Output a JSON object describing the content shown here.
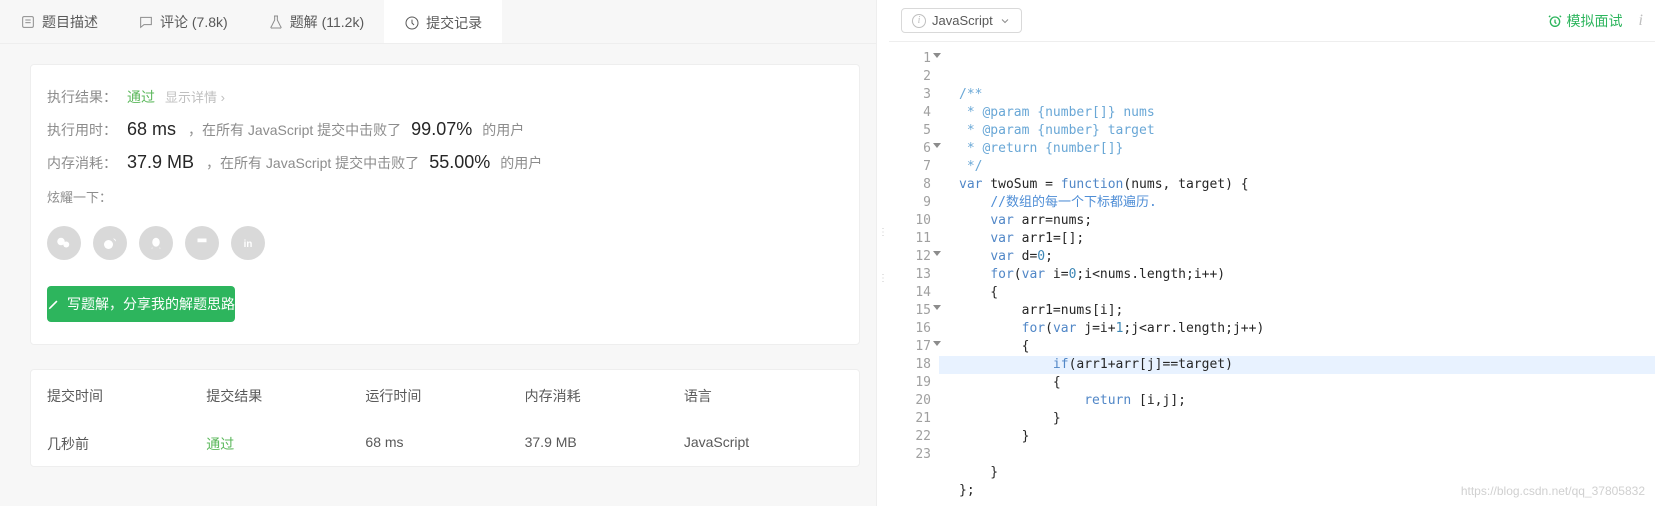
{
  "tabs": {
    "description": "题目描述",
    "comments": "评论 (7.8k)",
    "solutions": "题解 (11.2k)",
    "submissions": "提交记录"
  },
  "result": {
    "exec_label": "执行结果：",
    "pass": "通过",
    "detail_link": "显示详情 ›",
    "time_label": "执行用时：",
    "time_value": "68 ms",
    "time_text1": "，在所有 JavaScript 提交中击败了",
    "time_pct": "99.07%",
    "time_text2": "的用户",
    "mem_label": "内存消耗：",
    "mem_value": "37.9 MB",
    "mem_text1": "，在所有 JavaScript 提交中击败了",
    "mem_pct": "55.00%",
    "mem_text2": "的用户",
    "share_label": "炫耀一下：",
    "write_btn": "写题解，分享我的解题思路"
  },
  "table": {
    "headers": {
      "time": "提交时间",
      "result": "提交结果",
      "runtime": "运行时间",
      "memory": "内存消耗",
      "lang": "语言"
    },
    "row": {
      "time": "几秒前",
      "result": "通过",
      "runtime": "68 ms",
      "memory": "37.9 MB",
      "lang": "JavaScript"
    }
  },
  "right": {
    "language": "JavaScript",
    "mock": "模拟面试"
  },
  "code": {
    "lines": [
      {
        "n": 1,
        "fold": true,
        "segs": [
          {
            "c": "c-doc",
            "t": "/**"
          }
        ]
      },
      {
        "n": 2,
        "segs": [
          {
            "c": "c-doc",
            "t": " * @param {number[]} nums"
          }
        ]
      },
      {
        "n": 3,
        "segs": [
          {
            "c": "c-doc",
            "t": " * @param {number} target"
          }
        ]
      },
      {
        "n": 4,
        "segs": [
          {
            "c": "c-doc",
            "t": " * @return {number[]}"
          }
        ]
      },
      {
        "n": 5,
        "segs": [
          {
            "c": "c-doc",
            "t": " */"
          }
        ]
      },
      {
        "n": 6,
        "fold": true,
        "segs": [
          {
            "c": "c-kw",
            "t": "var"
          },
          {
            "c": "c-id",
            "t": " twoSum "
          },
          {
            "c": "c-punct",
            "t": "= "
          },
          {
            "c": "c-kw",
            "t": "function"
          },
          {
            "c": "c-punct",
            "t": "(nums, target) {"
          }
        ]
      },
      {
        "n": 7,
        "segs": [
          {
            "c": "c-id",
            "t": "    "
          },
          {
            "c": "c-cn",
            "t": "//数组的每一个下标都遍历."
          }
        ]
      },
      {
        "n": 8,
        "segs": [
          {
            "c": "c-id",
            "t": "    "
          },
          {
            "c": "c-kw",
            "t": "var"
          },
          {
            "c": "c-id",
            "t": " arr"
          },
          {
            "c": "c-punct",
            "t": "="
          },
          {
            "c": "c-id",
            "t": "nums"
          },
          {
            "c": "c-punct",
            "t": ";"
          }
        ]
      },
      {
        "n": 9,
        "segs": [
          {
            "c": "c-id",
            "t": "    "
          },
          {
            "c": "c-kw",
            "t": "var"
          },
          {
            "c": "c-id",
            "t": " arr1"
          },
          {
            "c": "c-punct",
            "t": "=[];"
          }
        ]
      },
      {
        "n": 10,
        "segs": [
          {
            "c": "c-id",
            "t": "    "
          },
          {
            "c": "c-kw",
            "t": "var"
          },
          {
            "c": "c-id",
            "t": " d"
          },
          {
            "c": "c-punct",
            "t": "="
          },
          {
            "c": "c-num",
            "t": "0"
          },
          {
            "c": "c-punct",
            "t": ";"
          }
        ]
      },
      {
        "n": 11,
        "segs": [
          {
            "c": "c-id",
            "t": "    "
          },
          {
            "c": "c-kw",
            "t": "for"
          },
          {
            "c": "c-punct",
            "t": "("
          },
          {
            "c": "c-kw",
            "t": "var"
          },
          {
            "c": "c-id",
            "t": " i"
          },
          {
            "c": "c-punct",
            "t": "="
          },
          {
            "c": "c-num",
            "t": "0"
          },
          {
            "c": "c-punct",
            "t": ";i<nums.length;i++)"
          }
        ]
      },
      {
        "n": 12,
        "fold": true,
        "segs": [
          {
            "c": "c-punct",
            "t": "    {"
          }
        ]
      },
      {
        "n": 13,
        "segs": [
          {
            "c": "c-id",
            "t": "        arr1"
          },
          {
            "c": "c-punct",
            "t": "="
          },
          {
            "c": "c-id",
            "t": "nums"
          },
          {
            "c": "c-punct",
            "t": "[i];"
          }
        ]
      },
      {
        "n": 14,
        "segs": [
          {
            "c": "c-id",
            "t": "        "
          },
          {
            "c": "c-kw",
            "t": "for"
          },
          {
            "c": "c-punct",
            "t": "("
          },
          {
            "c": "c-kw",
            "t": "var"
          },
          {
            "c": "c-id",
            "t": " j"
          },
          {
            "c": "c-punct",
            "t": "=i+"
          },
          {
            "c": "c-num",
            "t": "1"
          },
          {
            "c": "c-punct",
            "t": ";j<arr.length;j++)"
          }
        ]
      },
      {
        "n": 15,
        "fold": true,
        "segs": [
          {
            "c": "c-punct",
            "t": "        {"
          }
        ]
      },
      {
        "n": 16,
        "hl": true,
        "segs": [
          {
            "c": "c-id",
            "t": "            "
          },
          {
            "c": "c-kw",
            "t": "if"
          },
          {
            "c": "c-punct",
            "t": "(arr1+arr[j]==target)"
          }
        ]
      },
      {
        "n": 17,
        "fold": true,
        "segs": [
          {
            "c": "c-punct",
            "t": "            {"
          }
        ]
      },
      {
        "n": 18,
        "segs": [
          {
            "c": "c-id",
            "t": "                "
          },
          {
            "c": "c-kw",
            "t": "return"
          },
          {
            "c": "c-punct",
            "t": " [i,j];"
          }
        ]
      },
      {
        "n": 19,
        "segs": [
          {
            "c": "c-punct",
            "t": "            }"
          }
        ]
      },
      {
        "n": 20,
        "segs": [
          {
            "c": "c-punct",
            "t": "        }"
          }
        ]
      },
      {
        "n": 21,
        "segs": [
          {
            "c": "c-punct",
            "t": ""
          }
        ]
      },
      {
        "n": 22,
        "segs": [
          {
            "c": "c-punct",
            "t": "    }"
          }
        ]
      },
      {
        "n": 23,
        "segs": [
          {
            "c": "c-punct",
            "t": "};"
          }
        ]
      }
    ]
  },
  "watermark": "https://blog.csdn.net/qq_37805832"
}
